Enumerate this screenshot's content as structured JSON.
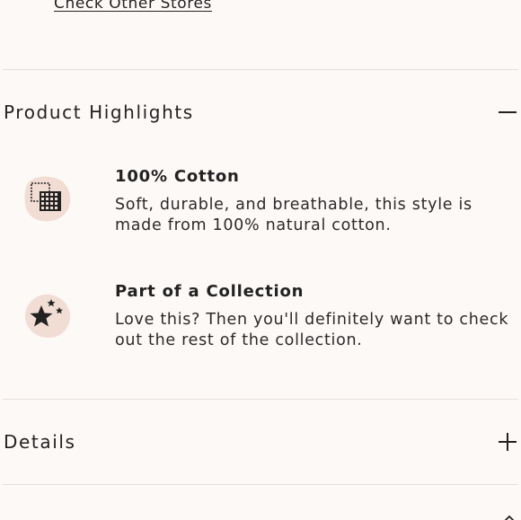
{
  "stores_link": {
    "label": "Check Other Stores"
  },
  "product_highlights": {
    "title": "Product Highlights",
    "expanded": true,
    "items": [
      {
        "icon": "fabric-swatch-icon",
        "title": "100% Cotton",
        "description": "Soft, durable, and breathable, this style is made from 100% natural cotton."
      },
      {
        "icon": "stars-icon",
        "title": "Part of a Collection",
        "description": "Love this? Then you'll definitely want to check out the rest of the collection."
      }
    ]
  },
  "details": {
    "title": "Details",
    "expanded": false
  },
  "colors": {
    "background": "#fdf9f7",
    "icon_blob": "#f1ddd4",
    "text": "#222222",
    "divider": "#e6e0dc"
  }
}
